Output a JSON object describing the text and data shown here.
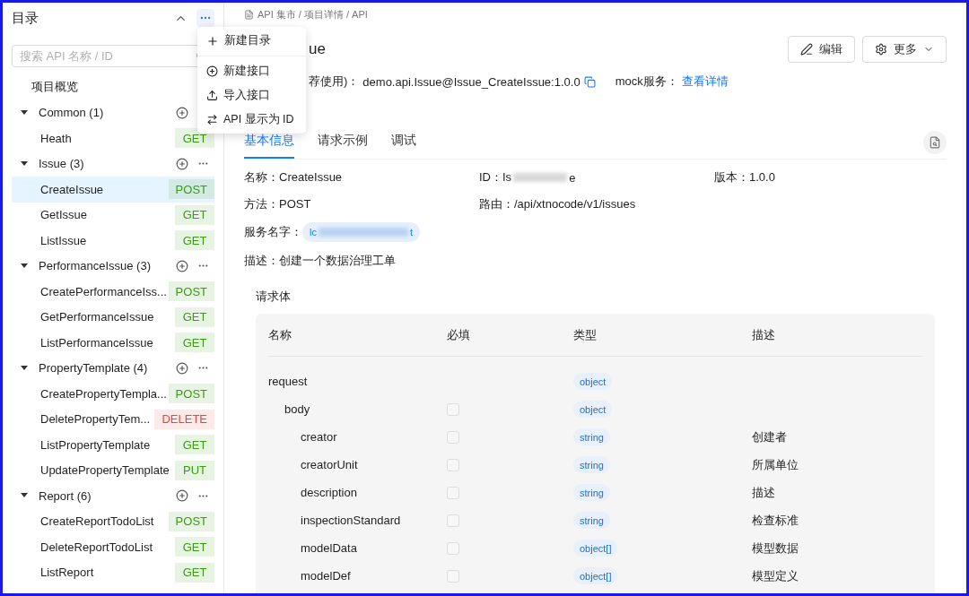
{
  "sidebar": {
    "title": "目录",
    "search": {
      "placeholder": "搜索 API 名称 / ID"
    },
    "overview": "项目概览",
    "groups": [
      {
        "name": "Common (1)",
        "expanded": true,
        "more": false,
        "children": [
          {
            "name": "Heath",
            "method": "GET",
            "color": "#389e0d",
            "selected": false
          }
        ]
      },
      {
        "name": "Issue (3)",
        "expanded": true,
        "more": true,
        "children": [
          {
            "name": "CreateIssue",
            "method": "POST",
            "color": "#389e0d",
            "selected": true
          },
          {
            "name": "GetIssue",
            "method": "GET",
            "color": "#389e0d",
            "selected": false
          },
          {
            "name": "ListIssue",
            "method": "GET",
            "color": "#389e0d",
            "selected": false
          }
        ]
      },
      {
        "name": "PerformanceIssue (3)",
        "expanded": true,
        "more": true,
        "children": [
          {
            "name": "CreatePerformanceIss...",
            "method": "POST",
            "color": "#389e0d",
            "selected": false
          },
          {
            "name": "GetPerformanceIssue",
            "method": "GET",
            "color": "#389e0d",
            "selected": false
          },
          {
            "name": "ListPerformanceIssue",
            "method": "GET",
            "color": "#389e0d",
            "selected": false
          }
        ]
      },
      {
        "name": "PropertyTemplate (4)",
        "expanded": true,
        "more": true,
        "children": [
          {
            "name": "CreatePropertyTempla...",
            "method": "POST",
            "color": "#389e0d",
            "selected": false
          },
          {
            "name": "DeletePropertyTem...",
            "method": "DELETE",
            "color": "#e5483b",
            "selected": false
          },
          {
            "name": "ListPropertyTemplate",
            "method": "GET",
            "color": "#389e0d",
            "selected": false
          },
          {
            "name": "UpdatePropertyTemplate",
            "method": "PUT",
            "color": "#389e0d",
            "selected": false
          }
        ]
      },
      {
        "name": "Report (6)",
        "expanded": true,
        "more": true,
        "children": [
          {
            "name": "CreateReportTodoList",
            "method": "POST",
            "color": "#389e0d",
            "selected": false
          },
          {
            "name": "DeleteReportTodoList",
            "method": "GET",
            "color": "#389e0d",
            "selected": false
          },
          {
            "name": "ListReport",
            "method": "GET",
            "color": "#389e0d",
            "selected": false
          }
        ]
      }
    ]
  },
  "menu": {
    "groups": [
      [
        {
          "kind": "plus",
          "label": "新建目录"
        }
      ],
      [
        {
          "kind": "plus-circle",
          "label": "新建接口"
        },
        {
          "kind": "upload",
          "label": "导入接口"
        },
        {
          "kind": "swap",
          "label": "API 显示为 ID"
        }
      ]
    ]
  },
  "breadcrumb": "API 集市 / 项目详情 / API",
  "title": "ue",
  "actions": [
    {
      "kind": "edit",
      "label": "编辑"
    },
    {
      "kind": "more",
      "label": "更多"
    }
  ],
  "identifier": {
    "label": "荐使用)：",
    "value": "demo.api.Issue@Issue_CreateIssue:1.0.0",
    "mock_label": "mock服务：",
    "mock_link": "查看详情"
  },
  "tabs": [
    {
      "label": "基本信息",
      "selected": true
    },
    {
      "label": "请求示例",
      "selected": false
    },
    {
      "label": "调试",
      "selected": false
    }
  ],
  "fields": [
    [
      {
        "label": "名称：",
        "value": "CreateIssue"
      },
      {
        "label": "ID：",
        "value": "Is",
        "redacted": true,
        "tail": "e"
      },
      {
        "label": "版本：",
        "value": "1.0.0"
      }
    ],
    [
      {
        "label": "方法：",
        "value": "POST"
      },
      {
        "label": "路由：",
        "value": "/api/xtnocode/v1/issues"
      }
    ]
  ],
  "service": {
    "label": "服务名字：",
    "head": "lc",
    "tail": "t"
  },
  "description": {
    "label": "描述：",
    "value": "创建一个数据治理工单"
  },
  "request_body": {
    "title": "请求体",
    "columns": [
      "名称",
      "必填",
      "类型",
      "描述"
    ],
    "rows": [
      {
        "name": "request",
        "type": "object",
        "children": [
          {
            "name": "body",
            "required": false,
            "type": "object",
            "children": [
              {
                "name": "creator",
                "required": false,
                "type": "string",
                "description": "创建者"
              },
              {
                "name": "creatorUnit",
                "required": false,
                "type": "string",
                "description": "所属单位"
              },
              {
                "name": "description",
                "required": false,
                "type": "string",
                "description": "描述"
              },
              {
                "name": "inspectionStandard",
                "required": false,
                "type": "string",
                "description": "检查标准"
              },
              {
                "name": "modelData",
                "required": false,
                "type": "object[]",
                "description": "模型数据"
              },
              {
                "name": "modelDef",
                "required": false,
                "type": "object[]",
                "description": "模型定义"
              }
            ]
          }
        ]
      }
    ]
  }
}
